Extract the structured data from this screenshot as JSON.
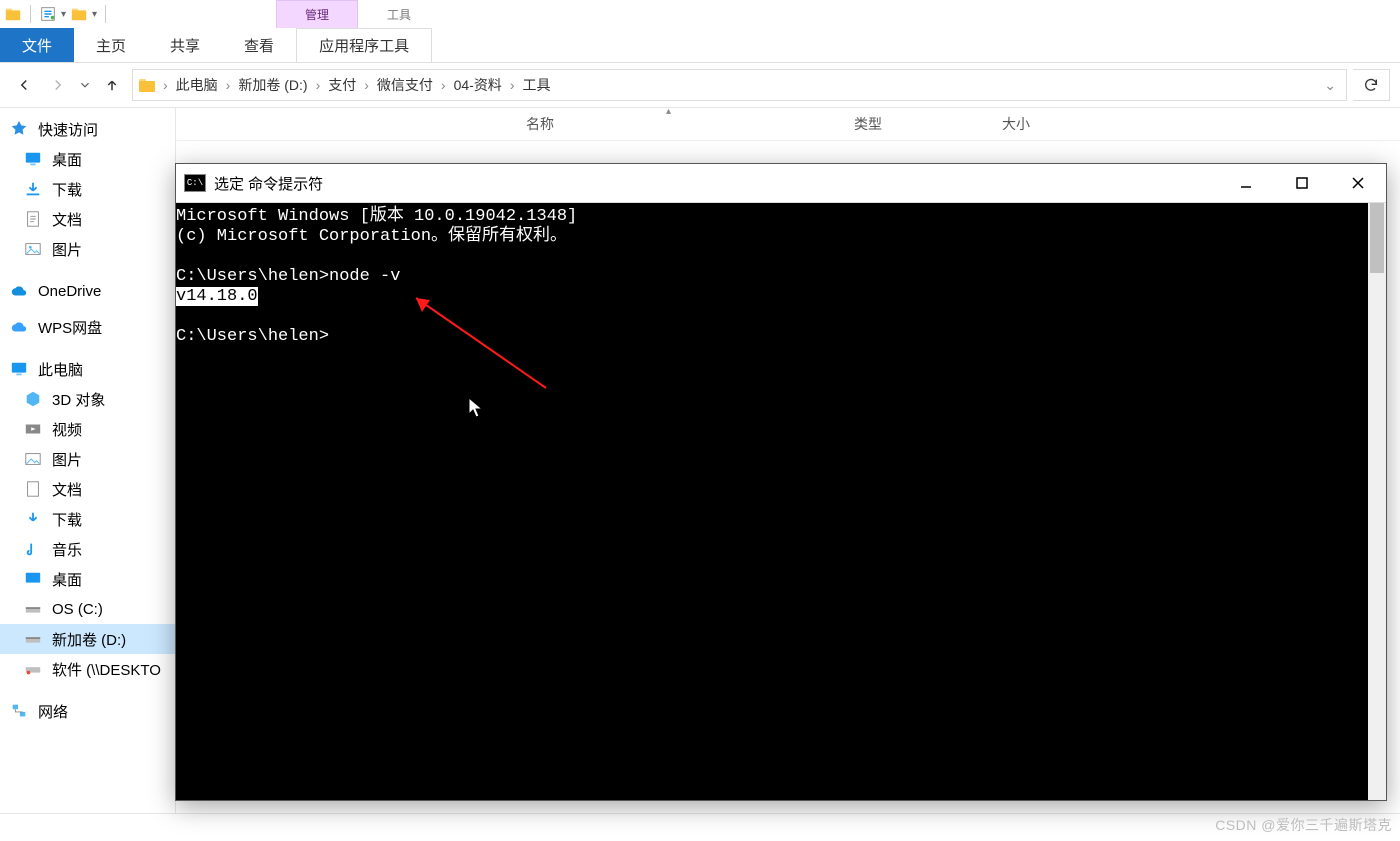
{
  "qat": {
    "chevron": "▾"
  },
  "context_tabs": {
    "manage": "管理",
    "tools": "工具"
  },
  "ribbon": {
    "file": "文件",
    "home": "主页",
    "share": "共享",
    "view": "查看",
    "app_tools": "应用程序工具"
  },
  "breadcrumbs": [
    "此电脑",
    "新加卷 (D:)",
    "支付",
    "微信支付",
    "04-资料",
    "工具"
  ],
  "columns": {
    "name": "名称",
    "type": "类型",
    "size": "大小",
    "sort": "▴"
  },
  "sidebar": {
    "quick": {
      "label": "快速访问",
      "items": [
        "桌面",
        "下载",
        "文档",
        "图片"
      ]
    },
    "onedrive": "OneDrive",
    "wps": "WPS网盘",
    "thispc": {
      "label": "此电脑",
      "items": [
        "3D 对象",
        "视频",
        "图片",
        "文档",
        "下载",
        "音乐",
        "桌面",
        "OS (C:)",
        "新加卷 (D:)",
        "软件 (\\\\DESKTO"
      ]
    },
    "network": "网络"
  },
  "cmd": {
    "title": "选定 命令提示符",
    "line1": "Microsoft Windows [版本 10.0.19042.1348]",
    "line2": "(c) Microsoft Corporation。保留所有权利。",
    "prompt1": "C:\\Users\\helen>node -v",
    "output": "v14.18.0",
    "prompt2": "C:\\Users\\helen>"
  },
  "watermark": "CSDN @爱你三千遍斯塔克"
}
